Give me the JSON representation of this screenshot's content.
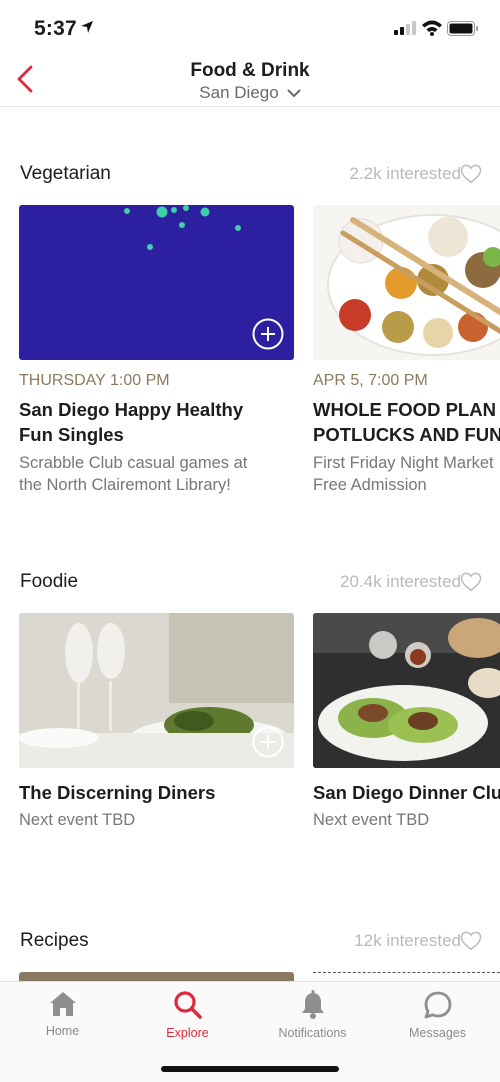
{
  "status": {
    "time": "5:37"
  },
  "nav": {
    "title": "Food & Drink",
    "location": "San Diego"
  },
  "sections": [
    {
      "title": "Vegetarian",
      "interest": "2.2k interested",
      "cards": [
        {
          "date": "THURSDAY 1:00 PM",
          "title_lines": [
            "San Diego Happy Healthy",
            "Fun Singles"
          ],
          "desc_lines": [
            "Scrabble Club casual games at",
            "the North Clairemont Library!"
          ]
        },
        {
          "date": "APR 5, 7:00 PM",
          "title_lines": [
            "WHOLE FOOD PLAN",
            "POTLUCKS AND FUN"
          ],
          "desc_lines": [
            "First Friday Night Market",
            "Free Admission"
          ]
        }
      ]
    },
    {
      "title": "Foodie",
      "interest": "20.4k interested",
      "cards": [
        {
          "title_lines": [
            "The Discerning Diners"
          ],
          "desc_lines": [
            "Next event TBD"
          ]
        },
        {
          "title_lines": [
            "San Diego Dinner Club"
          ],
          "desc_lines": [
            "Next event TBD"
          ]
        }
      ]
    },
    {
      "title": "Recipes",
      "interest": "12k interested"
    }
  ],
  "tabs": [
    {
      "label": "Home",
      "icon": "home-icon"
    },
    {
      "label": "Explore",
      "icon": "search-icon"
    },
    {
      "label": "Notifications",
      "icon": "bell-icon"
    },
    {
      "label": "Messages",
      "icon": "message-bubble-icon"
    }
  ],
  "colors": {
    "accent": "#e0283e",
    "date": "#8d7a5e",
    "vegetarian_thumb": "#2c1fa0",
    "dots": "#3fd0a8"
  }
}
